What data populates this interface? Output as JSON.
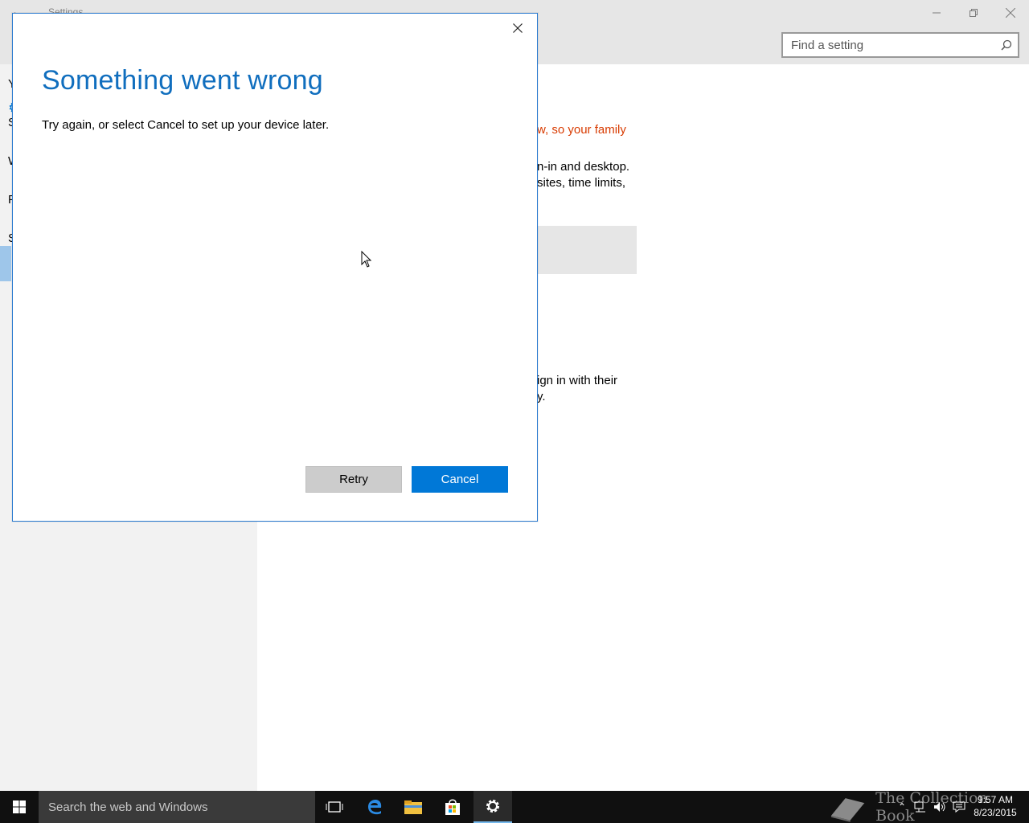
{
  "window": {
    "title": "Settings",
    "back_icon": "back-arrow-icon",
    "controls": [
      "minimize-icon",
      "restore-icon",
      "close-icon"
    ]
  },
  "search": {
    "placeholder": "Find a setting",
    "icon": "search-icon"
  },
  "sidebar": {
    "items": [
      {
        "label": "Y"
      },
      {
        "label": "S"
      },
      {
        "label": "W"
      },
      {
        "label": "F",
        "selected": true
      },
      {
        "label": "S"
      }
    ]
  },
  "content": {
    "warning": "w, so your family",
    "line1": "n-in and desktop.",
    "line2": "sites, time limits,",
    "line3": "ign in with their",
    "line4": "y."
  },
  "dialog": {
    "title": "Something went wrong",
    "message": "Try again, or select Cancel to set up your device later.",
    "retry_label": "Retry",
    "cancel_label": "Cancel",
    "close_icon": "close-icon"
  },
  "taskbar": {
    "search_placeholder": "Search the web and Windows",
    "watermark": "The Collection Book",
    "time": "9:57 AM",
    "date": "8/23/2015",
    "icons": [
      "windows-start-icon",
      "task-view-icon",
      "edge-icon",
      "file-explorer-icon",
      "store-icon",
      "settings-gear-icon"
    ]
  },
  "colors": {
    "accent": "#0078d7",
    "title_blue": "#106ebe",
    "warning": "#d83b01",
    "taskbar": "#101010"
  }
}
